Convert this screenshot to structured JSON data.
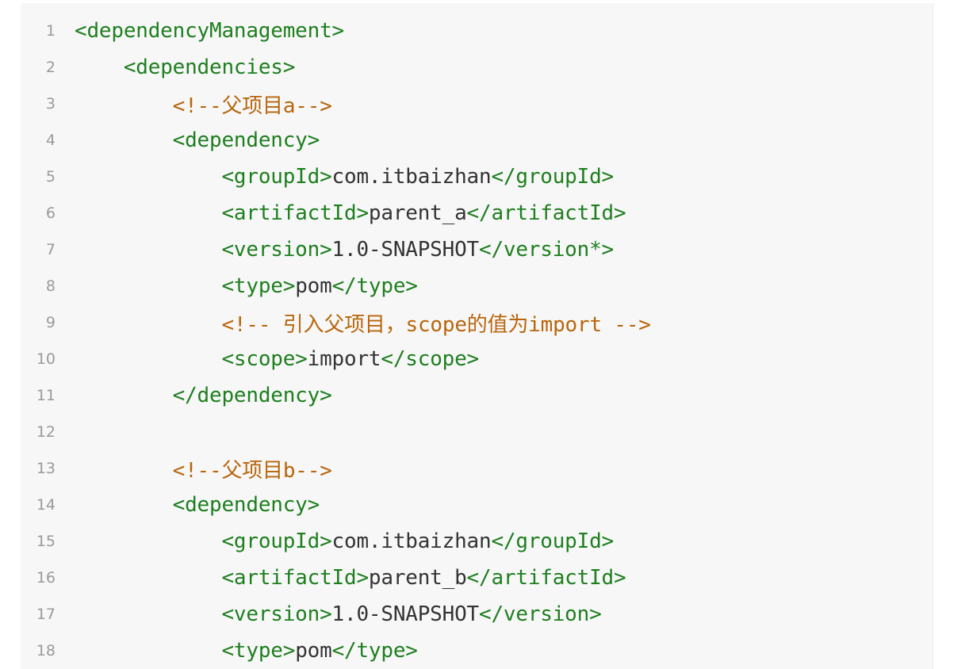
{
  "lines": [
    {
      "num": "1",
      "segments": [
        {
          "cls": "tag",
          "text": "<dependencyManagement>"
        }
      ]
    },
    {
      "num": "2",
      "segments": [
        {
          "cls": "text",
          "text": "    "
        },
        {
          "cls": "tag",
          "text": "<dependencies>"
        }
      ]
    },
    {
      "num": "3",
      "segments": [
        {
          "cls": "text",
          "text": "        "
        },
        {
          "cls": "comment",
          "text": "<!--父项目a-->"
        }
      ]
    },
    {
      "num": "4",
      "segments": [
        {
          "cls": "text",
          "text": "        "
        },
        {
          "cls": "tag",
          "text": "<dependency>"
        }
      ]
    },
    {
      "num": "5",
      "segments": [
        {
          "cls": "text",
          "text": "            "
        },
        {
          "cls": "tag",
          "text": "<groupId>"
        },
        {
          "cls": "text",
          "text": "com.itbaizhan"
        },
        {
          "cls": "tag",
          "text": "</groupId>"
        }
      ]
    },
    {
      "num": "6",
      "segments": [
        {
          "cls": "text",
          "text": "            "
        },
        {
          "cls": "tag",
          "text": "<artifactId>"
        },
        {
          "cls": "text",
          "text": "parent_a"
        },
        {
          "cls": "tag",
          "text": "</artifactId>"
        }
      ]
    },
    {
      "num": "7",
      "segments": [
        {
          "cls": "text",
          "text": "            "
        },
        {
          "cls": "tag",
          "text": "<version>"
        },
        {
          "cls": "text",
          "text": "1.0-SNAPSHOT"
        },
        {
          "cls": "tag",
          "text": "</version*>"
        }
      ]
    },
    {
      "num": "8",
      "segments": [
        {
          "cls": "text",
          "text": "            "
        },
        {
          "cls": "tag",
          "text": "<type>"
        },
        {
          "cls": "text",
          "text": "pom"
        },
        {
          "cls": "tag",
          "text": "</type>"
        }
      ]
    },
    {
      "num": "9",
      "segments": [
        {
          "cls": "text",
          "text": "            "
        },
        {
          "cls": "comment",
          "text": "<!-- 引入父项目，scope的值为import -->"
        }
      ]
    },
    {
      "num": "10",
      "segments": [
        {
          "cls": "text",
          "text": "            "
        },
        {
          "cls": "tag",
          "text": "<scope>"
        },
        {
          "cls": "text",
          "text": "import"
        },
        {
          "cls": "tag",
          "text": "</scope>"
        }
      ]
    },
    {
      "num": "11",
      "segments": [
        {
          "cls": "text",
          "text": "        "
        },
        {
          "cls": "tag",
          "text": "</dependency>"
        }
      ]
    },
    {
      "num": "12",
      "segments": []
    },
    {
      "num": "13",
      "segments": [
        {
          "cls": "text",
          "text": "        "
        },
        {
          "cls": "comment",
          "text": "<!--父项目b-->"
        }
      ]
    },
    {
      "num": "14",
      "segments": [
        {
          "cls": "text",
          "text": "        "
        },
        {
          "cls": "tag",
          "text": "<dependency>"
        }
      ]
    },
    {
      "num": "15",
      "segments": [
        {
          "cls": "text",
          "text": "            "
        },
        {
          "cls": "tag",
          "text": "<groupId>"
        },
        {
          "cls": "text",
          "text": "com.itbaizhan"
        },
        {
          "cls": "tag",
          "text": "</groupId>"
        }
      ]
    },
    {
      "num": "16",
      "segments": [
        {
          "cls": "text",
          "text": "            "
        },
        {
          "cls": "tag",
          "text": "<artifactId>"
        },
        {
          "cls": "text",
          "text": "parent_b"
        },
        {
          "cls": "tag",
          "text": "</artifactId>"
        }
      ]
    },
    {
      "num": "17",
      "segments": [
        {
          "cls": "text",
          "text": "            "
        },
        {
          "cls": "tag",
          "text": "<version>"
        },
        {
          "cls": "text",
          "text": "1.0-SNAPSHOT"
        },
        {
          "cls": "tag",
          "text": "</version>"
        }
      ]
    },
    {
      "num": "18",
      "segments": [
        {
          "cls": "text",
          "text": "            "
        },
        {
          "cls": "tag",
          "text": "<type>"
        },
        {
          "cls": "text",
          "text": "pom"
        },
        {
          "cls": "tag",
          "text": "</type>"
        }
      ]
    }
  ],
  "colors": {
    "tag": "#1e7f1e",
    "text": "#333333",
    "comment": "#b8660b",
    "line_number": "#9a9a9a",
    "background": "#f7f7f8"
  }
}
